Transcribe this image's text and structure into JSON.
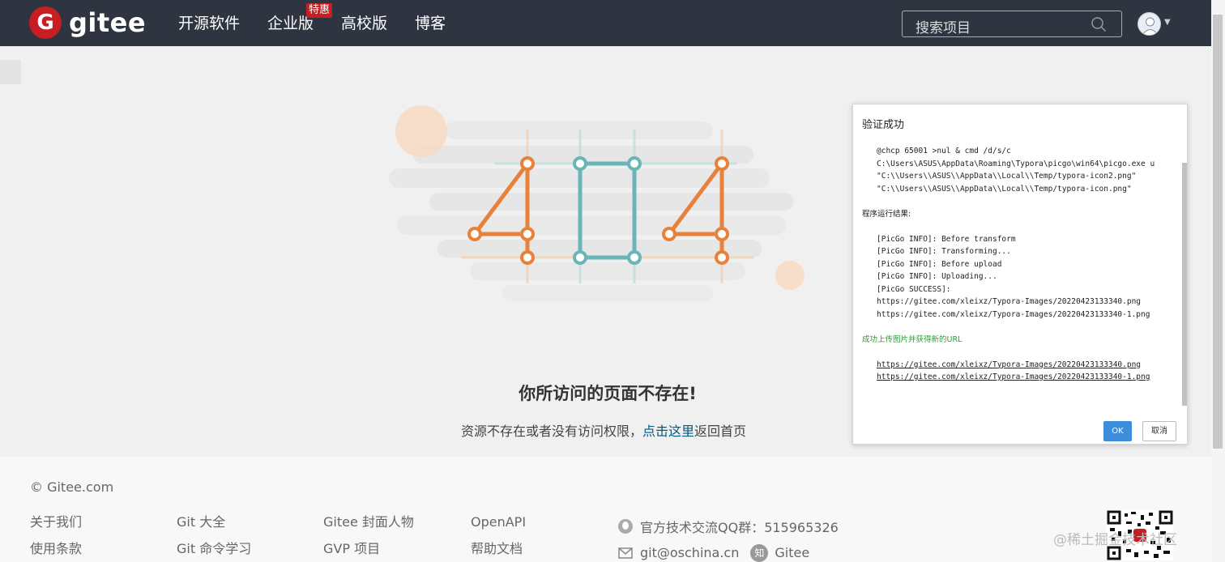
{
  "header": {
    "logo_mark": "G",
    "logo_text": "gitee",
    "nav": [
      {
        "label": "开源软件"
      },
      {
        "label": "企业版",
        "badge": "特惠"
      },
      {
        "label": "高校版"
      },
      {
        "label": "博客"
      }
    ],
    "search_placeholder": "搜索项目"
  },
  "main": {
    "illustration_text": "404",
    "title": "你所访问的页面不存在!",
    "subtitle_before": "资源不存在或者没有访问权限，",
    "subtitle_link": "点击这里",
    "subtitle_after": "返回首页"
  },
  "dialog": {
    "title": "验证成功",
    "cmd_lines": [
      "@chcp 65001 >nul & cmd /d/s/c",
      "C:\\Users\\ASUS\\AppData\\Roaming\\Typora\\picgo\\win64\\picgo.exe u",
      "\"C:\\\\Users\\\\ASUS\\\\AppData\\\\Local\\\\Temp/typora-icon2.png\"",
      "\"C:\\\\Users\\\\ASUS\\\\AppData\\\\Local\\\\Temp/typora-icon.png\""
    ],
    "result_label": "程序运行结果:",
    "log_lines": [
      "[PicGo INFO]: Before transform",
      "[PicGo INFO]: Transforming...",
      "[PicGo INFO]: Before upload",
      "[PicGo INFO]: Uploading...",
      "[PicGo SUCCESS]:",
      "https://gitee.com/xleixz/Typora-Images/20220423133340.png",
      "https://gitee.com/xleixz/Typora-Images/20220423133340-1.png"
    ],
    "success_label": "成功上传图片并获得新的URL",
    "url_lines": [
      "https://gitee.com/xleixz/Typora-Images/20220423133340.png",
      "https://gitee.com/xleixz/Typora-Images/20220423133340-1.png"
    ],
    "ok_label": "OK",
    "cancel_label": "取消"
  },
  "footer": {
    "copyright": "© Gitee.com",
    "columns": [
      [
        "关于我们",
        "使用条款"
      ],
      [
        "Git 大全",
        "Git 命令学习"
      ],
      [
        "Gitee 封面人物",
        "GVP 项目"
      ],
      [
        "OpenAPI",
        "帮助文档"
      ]
    ],
    "qq_group": "官方技术交流QQ群：515965326",
    "email": "git@oschina.cn",
    "zhihu_mark": "知",
    "zhihu_label": "Gitee",
    "watermark": "@稀土掘金技术社区"
  },
  "colors": {
    "header_bg": "#2f3540",
    "brand_red": "#c71d23",
    "orange": "#e8823a",
    "teal": "#6bb5b9",
    "link": "#005980",
    "ok_button": "#3c8ddc",
    "success_green": "#2e9d38"
  }
}
